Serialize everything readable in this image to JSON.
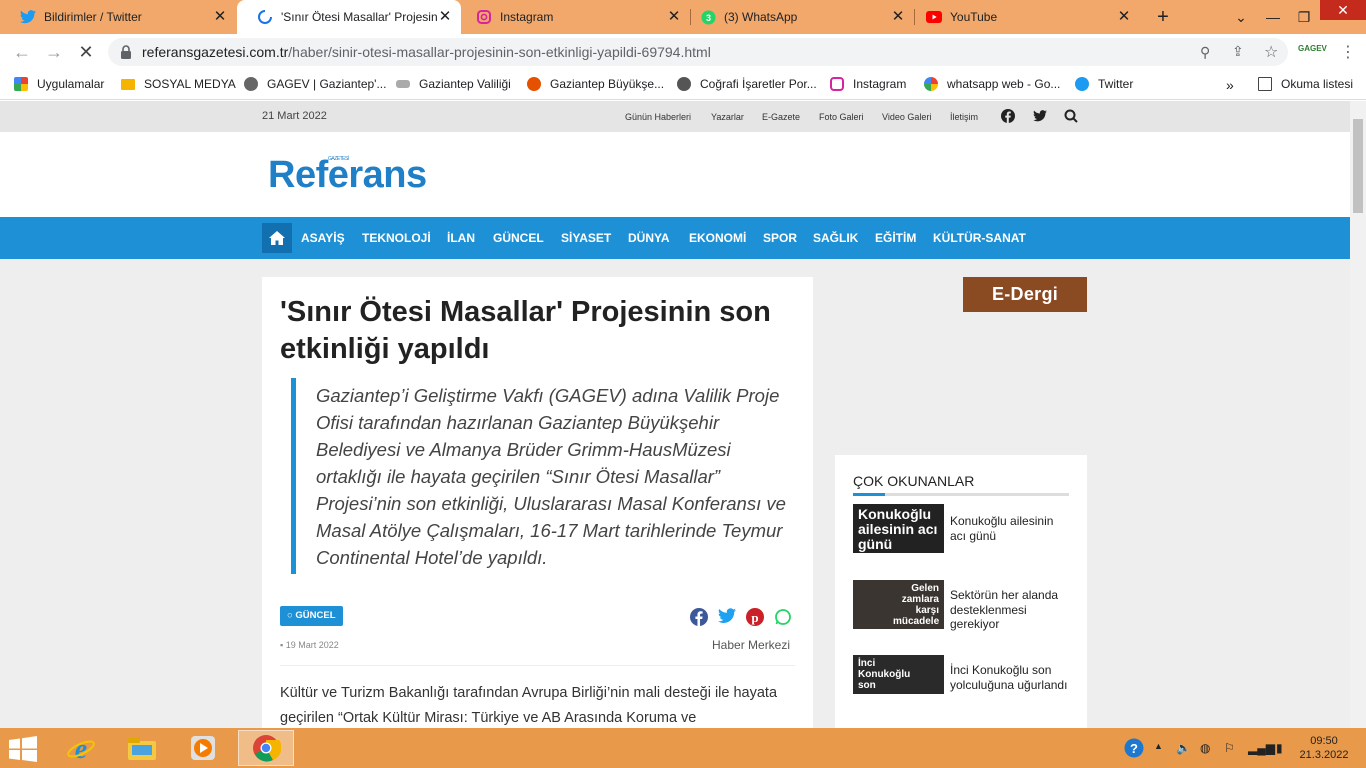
{
  "browser": {
    "tabs": [
      {
        "title": "Bildirimler / Twitter",
        "icon": "twitter-icon"
      },
      {
        "title": "'Sınır Ötesi Masallar' Projesinin",
        "icon": "loading-icon"
      },
      {
        "title": "Instagram",
        "icon": "instagram-icon"
      },
      {
        "title": "(3) WhatsApp",
        "icon": "whatsapp-icon"
      },
      {
        "title": "YouTube",
        "icon": "youtube-icon"
      }
    ],
    "url_host": "referansgazetesi.com.tr",
    "url_path": "/haber/sinir-otesi-masallar-projesinin-son-etkinligi-yapildi-69794.html",
    "profile_label": "GAGEV",
    "bookmarks": [
      "Uygulamalar",
      "SOSYAL MEDYA",
      "GAGEV | Gaziantep'...",
      "Gaziantep Valiliği",
      "Gaziantep Büyükşe...",
      "Coğrafi İşaretler Por...",
      "Instagram",
      "whatsapp web - Go...",
      "Twitter"
    ],
    "reading_list": "Okuma listesi"
  },
  "site": {
    "date": "21 Mart 2022",
    "top_links": [
      "Günün Haberleri",
      "Yazarlar",
      "E-Gazete",
      "Foto Galeri",
      "Video Galeri",
      "İletişim"
    ],
    "logo": "Referans",
    "logo_tag": "GAZETESİ",
    "menu": [
      "ASAYİŞ",
      "TEKNOLOJİ",
      "İLAN",
      "GÜNCEL",
      "SİYASET",
      "DÜNYA",
      "EKONOMİ",
      "SPOR",
      "SAĞLIK",
      "EĞİTİM",
      "KÜLTÜR-SANAT"
    ]
  },
  "article": {
    "title": "'Sınır Ötesi Masallar' Projesinin son etkinliği yapıldı",
    "lead": "Gaziantep’i Geliştirme Vakfı (GAGEV) adına Valilik Proje Ofisi tarafından hazırlanan Gaziantep Büyükşehir Belediyesi ve Almanya Brüder Grimm-HausMüzesi ortaklığı ile hayata geçirilen “Sınır Ötesi Masallar” Projesi’nin son etkinliği,  Uluslararası Masal Konferansı ve Masal Atölye Çalışmaları, 16-17 Mart tarihlerinde Teymur Continental Hotel’de yapıldı.",
    "category": "GÜNCEL",
    "date": "19 Mart 2022",
    "author": "Haber Merkezi",
    "body": "Kültür ve Turizm Bakanlığı tarafından Avrupa Birliği’nin mali desteği ile hayata geçirilen “Ortak Kültür Mirası: Türkiye ve AB Arasında Koruma ve"
  },
  "sidebar": {
    "edergi": "E-Dergi",
    "popular_title": "ÇOK OKUNANLAR",
    "items": [
      {
        "thumb": "Konukoğlu ailesinin acı günü",
        "text": "Konukoğlu ailesinin acı günü"
      },
      {
        "thumb": "Gelen zamlara karşı mücadele",
        "text": "Sektörün her alanda desteklenmesi gerekiyor"
      },
      {
        "thumb": "İnci Konukoğlu son",
        "text": "İnci Konukoğlu son yolculuğuna uğurlandı"
      }
    ]
  },
  "taskbar": {
    "time": "09:50",
    "date": "21.3.2022"
  },
  "colors": {
    "accent": "#1e90d5",
    "tabbar": "#f1a86a",
    "taskbar": "#e89a4a"
  }
}
